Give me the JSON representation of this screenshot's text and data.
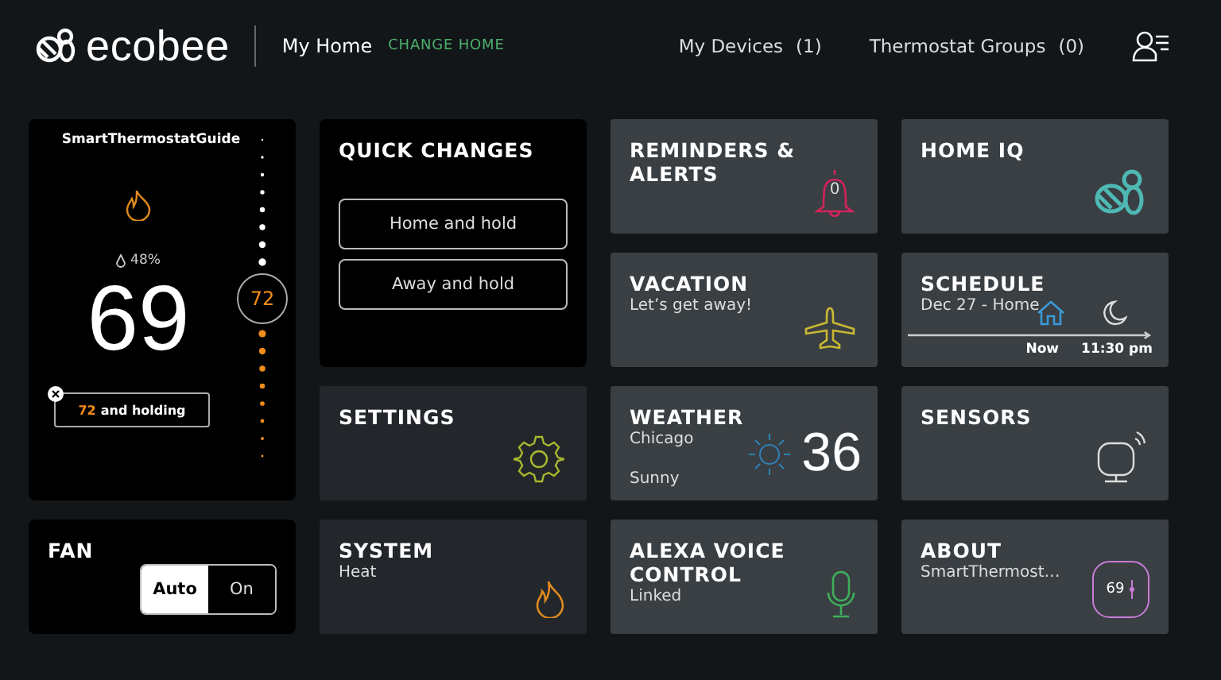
{
  "header": {
    "brand": "ecobee",
    "home": "My Home",
    "change_home": "CHANGE HOME",
    "nav": [
      {
        "label": "My Devices",
        "count": "(1)"
      },
      {
        "label": "Thermostat Groups",
        "count": "(0)"
      }
    ]
  },
  "thermostat": {
    "name": "SmartThermostatGuide",
    "humidity": "48%",
    "temperature": "69",
    "setpoint": "72",
    "hold_setpoint": "72",
    "hold_text": "and holding"
  },
  "quick_changes": {
    "title": "QUICK CHANGES",
    "buttons": [
      "Home and hold",
      "Away and hold"
    ]
  },
  "fan": {
    "title": "FAN",
    "options": [
      {
        "label": "Auto",
        "selected": true
      },
      {
        "label": "On",
        "selected": false
      }
    ]
  },
  "tiles": [
    {
      "kind": "reminders",
      "title": "REMINDERS & ALERTS",
      "badge": "0"
    },
    {
      "kind": "home_iq",
      "title": "HOME IQ"
    },
    {
      "kind": "vacation",
      "title": "VACATION",
      "subtitle": "Let’s get away!"
    },
    {
      "kind": "schedule",
      "title": "SCHEDULE",
      "subtitle": "Dec 27 - Home",
      "now": "Now",
      "next": "11:30 pm"
    },
    {
      "kind": "settings",
      "title": "SETTINGS"
    },
    {
      "kind": "weather",
      "title": "WEATHER",
      "subtitle": "Chicago",
      "condition": "Sunny",
      "temperature": "36"
    },
    {
      "kind": "sensors",
      "title": "SENSORS"
    },
    {
      "kind": "system",
      "title": "SYSTEM",
      "subtitle": "Heat"
    },
    {
      "kind": "alexa",
      "title": "ALEXA VOICE CONTROL",
      "subtitle": "Linked"
    },
    {
      "kind": "about",
      "title": "ABOUT",
      "subtitle": "SmartThermost…",
      "reading": "69"
    }
  ]
}
